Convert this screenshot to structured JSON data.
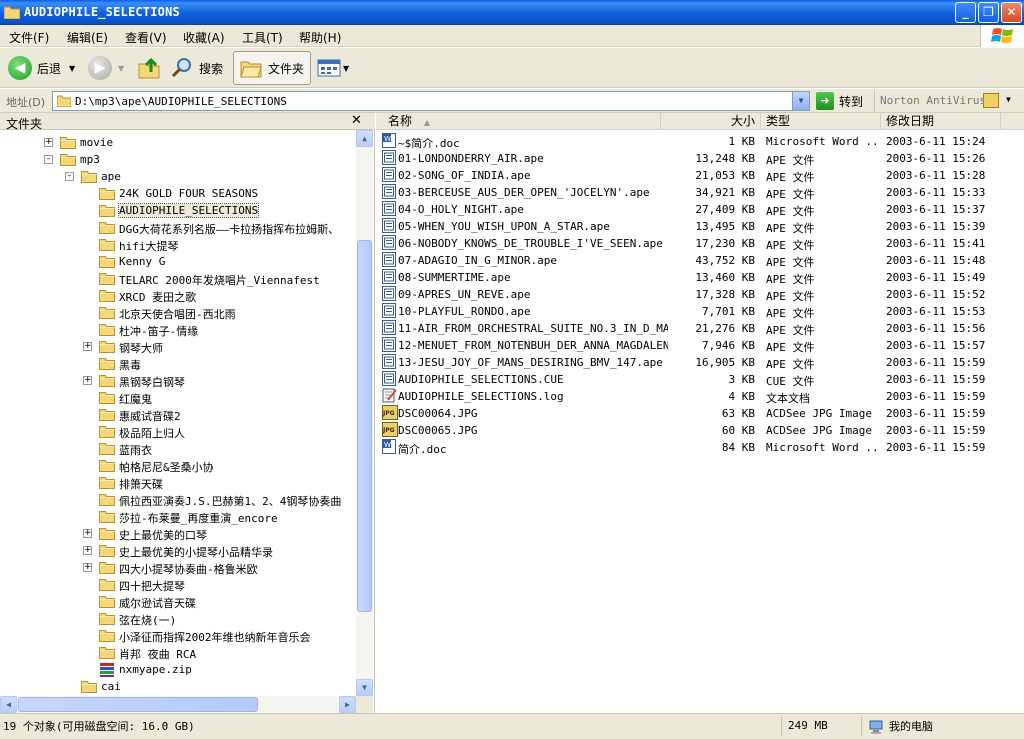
{
  "window": {
    "title": "AUDIOPHILE_SELECTIONS"
  },
  "menu": [
    "文件(F)",
    "编辑(E)",
    "查看(V)",
    "收藏(A)",
    "工具(T)",
    "帮助(H)"
  ],
  "toolbar": {
    "back": "后退",
    "search": "搜索",
    "folders": "文件夹"
  },
  "address": {
    "label": "地址(D)",
    "path": "D:\\mp3\\ape\\AUDIOPHILE_SELECTIONS",
    "go": "转到",
    "norton": "Norton AntiVirus"
  },
  "left_pane": {
    "title": "文件夹",
    "tree": [
      {
        "label": "movie",
        "level": 0,
        "expander": "+"
      },
      {
        "label": "mp3",
        "level": 0,
        "expander": "-"
      },
      {
        "label": "ape",
        "level": 1,
        "expander": "-"
      },
      {
        "label": "24K GOLD FOUR SEASONS",
        "level": 2
      },
      {
        "label": "AUDIOPHILE_SELECTIONS",
        "level": 2,
        "selected": true
      },
      {
        "label": "DGG大荷花系列名版——卡拉扬指挥布拉姆斯、",
        "level": 2
      },
      {
        "label": "hifi大提琴",
        "level": 2
      },
      {
        "label": "Kenny G",
        "level": 2
      },
      {
        "label": "TELARC 2000年发烧唱片_Viennafest",
        "level": 2
      },
      {
        "label": "XRCD 麦田之歌",
        "level": 2
      },
      {
        "label": "北京天使合唱团-西北雨",
        "level": 2
      },
      {
        "label": "杜冲-笛子-情缘",
        "level": 2
      },
      {
        "label": "钢琴大师",
        "level": 2,
        "expander": "+"
      },
      {
        "label": "黑毒",
        "level": 2
      },
      {
        "label": "黑钢琴白钢琴",
        "level": 2,
        "expander": "+"
      },
      {
        "label": "红魔鬼",
        "level": 2
      },
      {
        "label": "惠威试音碟2",
        "level": 2
      },
      {
        "label": "极品陌上归人",
        "level": 2
      },
      {
        "label": "蓝雨衣",
        "level": 2
      },
      {
        "label": "帕格尼尼&圣桑小协",
        "level": 2
      },
      {
        "label": "排箫天碟",
        "level": 2
      },
      {
        "label": "佩拉西亚演奏J.S.巴赫第1、2、4钢琴协奏曲",
        "level": 2
      },
      {
        "label": "莎拉-布莱曼_再度重演_encore",
        "level": 2
      },
      {
        "label": "史上最优美的口琴",
        "level": 2,
        "expander": "+"
      },
      {
        "label": "史上最优美的小提琴小品精华录",
        "level": 2,
        "expander": "+"
      },
      {
        "label": "四大小提琴协奏曲-格鲁米欧",
        "level": 2,
        "expander": "+"
      },
      {
        "label": "四十把大提琴",
        "level": 2
      },
      {
        "label": "威尔逊试音天碟",
        "level": 2
      },
      {
        "label": "弦在烧(一)",
        "level": 2
      },
      {
        "label": "小泽征而指挥2002年维也纳新年音乐会",
        "level": 2
      },
      {
        "label": "肖邦 夜曲 RCA",
        "level": 2
      },
      {
        "label": "nxmyape.zip",
        "level": 2,
        "icon": "zip"
      },
      {
        "label": "cai",
        "level": 1
      }
    ]
  },
  "columns": {
    "name": "名称",
    "size": "大小",
    "type": "类型",
    "modified": "修改日期"
  },
  "files": [
    {
      "name": "~$简介.doc",
      "size": "1 KB",
      "type": "Microsoft Word ...",
      "date": "2003-6-11 15:24",
      "icon": "word"
    },
    {
      "name": "01-LONDONDERRY_AIR.ape",
      "size": "13,248 KB",
      "type": "APE 文件",
      "date": "2003-6-11 15:26",
      "icon": "ape"
    },
    {
      "name": "02-SONG_OF_INDIA.ape",
      "size": "21,053 KB",
      "type": "APE 文件",
      "date": "2003-6-11 15:28",
      "icon": "ape"
    },
    {
      "name": "03-BERCEUSE_AUS_DER_OPEN_'JOCELYN'.ape",
      "size": "34,921 KB",
      "type": "APE 文件",
      "date": "2003-6-11 15:33",
      "icon": "ape"
    },
    {
      "name": "04-O_HOLY_NIGHT.ape",
      "size": "27,409 KB",
      "type": "APE 文件",
      "date": "2003-6-11 15:37",
      "icon": "ape"
    },
    {
      "name": "05-WHEN_YOU_WISH_UPON_A_STAR.ape",
      "size": "13,495 KB",
      "type": "APE 文件",
      "date": "2003-6-11 15:39",
      "icon": "ape"
    },
    {
      "name": "06-NOBODY_KNOWS_DE_TROUBLE_I'VE_SEEN.ape",
      "size": "17,230 KB",
      "type": "APE 文件",
      "date": "2003-6-11 15:41",
      "icon": "ape"
    },
    {
      "name": "07-ADAGIO_IN_G_MINOR.ape",
      "size": "43,752 KB",
      "type": "APE 文件",
      "date": "2003-6-11 15:48",
      "icon": "ape"
    },
    {
      "name": "08-SUMMERTIME.ape",
      "size": "13,460 KB",
      "type": "APE 文件",
      "date": "2003-6-11 15:49",
      "icon": "ape"
    },
    {
      "name": "09-APRES_UN_REVE.ape",
      "size": "17,328 KB",
      "type": "APE 文件",
      "date": "2003-6-11 15:52",
      "icon": "ape"
    },
    {
      "name": "10-PLAYFUL_RONDO.ape",
      "size": "7,701 KB",
      "type": "APE 文件",
      "date": "2003-6-11 15:53",
      "icon": "ape"
    },
    {
      "name": "11-AIR_FROM_ORCHESTRAL_SUITE_NO.3_IN_D_MA...",
      "size": "21,276 KB",
      "type": "APE 文件",
      "date": "2003-6-11 15:56",
      "icon": "ape"
    },
    {
      "name": "12-MENUET_FROM_NOTENBUH_DER_ANNA_MAGDALEN...",
      "size": "7,946 KB",
      "type": "APE 文件",
      "date": "2003-6-11 15:57",
      "icon": "ape"
    },
    {
      "name": "13-JESU_JOY_OF_MANS_DESIRING_BMV_147.ape",
      "size": "16,905 KB",
      "type": "APE 文件",
      "date": "2003-6-11 15:59",
      "icon": "ape"
    },
    {
      "name": "AUDIOPHILE_SELECTIONS.CUE",
      "size": "3 KB",
      "type": "CUE 文件",
      "date": "2003-6-11 15:59",
      "icon": "ape"
    },
    {
      "name": "AUDIOPHILE_SELECTIONS.log",
      "size": "4 KB",
      "type": "文本文档",
      "date": "2003-6-11 15:59",
      "icon": "txt"
    },
    {
      "name": "DSC00064.JPG",
      "size": "63 KB",
      "type": "ACDSee JPG Image",
      "date": "2003-6-11 15:59",
      "icon": "jpg"
    },
    {
      "name": "DSC00065.JPG",
      "size": "60 KB",
      "type": "ACDSee JPG Image",
      "date": "2003-6-11 15:59",
      "icon": "jpg"
    },
    {
      "name": "简介.doc",
      "size": "84 KB",
      "type": "Microsoft Word ...",
      "date": "2003-6-11 15:59",
      "icon": "word"
    }
  ],
  "status": {
    "objects": "19 个对象(可用磁盘空间: 16.0 GB)",
    "size": "249 MB",
    "location": "我的电脑"
  }
}
